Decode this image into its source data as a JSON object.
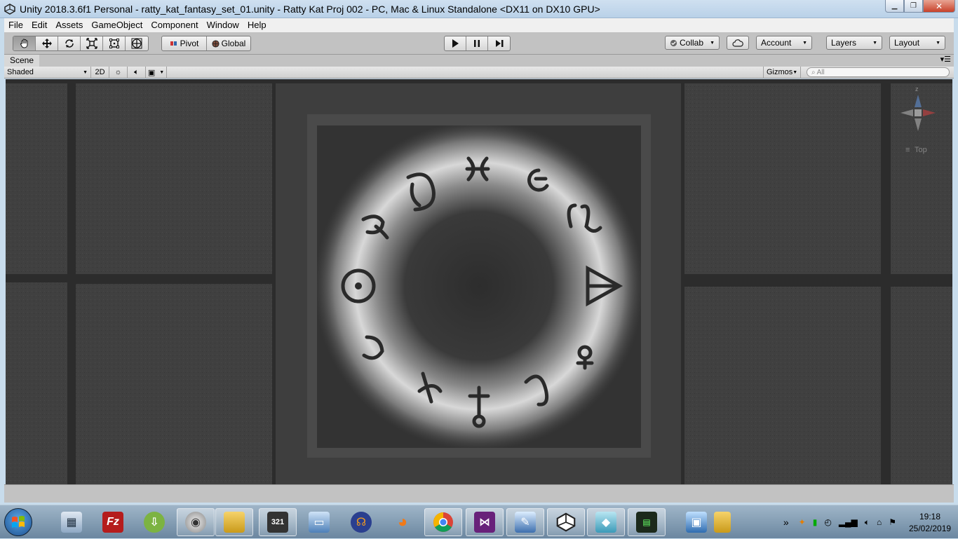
{
  "window": {
    "title": "Unity 2018.3.6f1 Personal - ratty_kat_fantasy_set_01.unity - Ratty Kat Proj 002 - PC, Mac & Linux Standalone <DX11 on DX10 GPU>",
    "minimize": "▁",
    "maximize": "❐",
    "close": "✕"
  },
  "menu": [
    "File",
    "Edit",
    "Assets",
    "GameObject",
    "Component",
    "Window",
    "Help"
  ],
  "toolbar": {
    "transform_tools": [
      "hand-tool",
      "move-tool",
      "rotate-tool",
      "scale-tool",
      "rect-tool",
      "transform-tool"
    ],
    "pivot_label": "Pivot",
    "global_label": "Global",
    "play_controls": [
      "play",
      "pause",
      "step"
    ],
    "collab_label": "Collab",
    "account_label": "Account",
    "layers_label": "Layers",
    "layout_label": "Layout"
  },
  "scene": {
    "tab_label": "Scene",
    "shading_mode": "Shaded",
    "mode_2d": "2D",
    "gizmos_label": "Gizmos",
    "search_placeholder": "All",
    "view_label": "Top",
    "gizmo_axis": "z"
  },
  "taskbar": {
    "apps": [
      "calculator",
      "filezilla",
      "android-file-transfer",
      "speaker",
      "file-manager",
      "video-editor",
      "remote-desktop",
      "headphones-app",
      "blender",
      "chrome",
      "visual-studio",
      "paint-editor",
      "unity",
      "sketchup",
      "terminal",
      "computer",
      "folder"
    ],
    "filezilla_label": "Fz",
    "video_label": "321",
    "overflow": "»",
    "time": "19:18",
    "date": "25/02/2019"
  },
  "colors": {
    "unity_gray": "#c2c2c2",
    "viewport_floor": "#3a3a3a",
    "glow": "#ffffff"
  }
}
